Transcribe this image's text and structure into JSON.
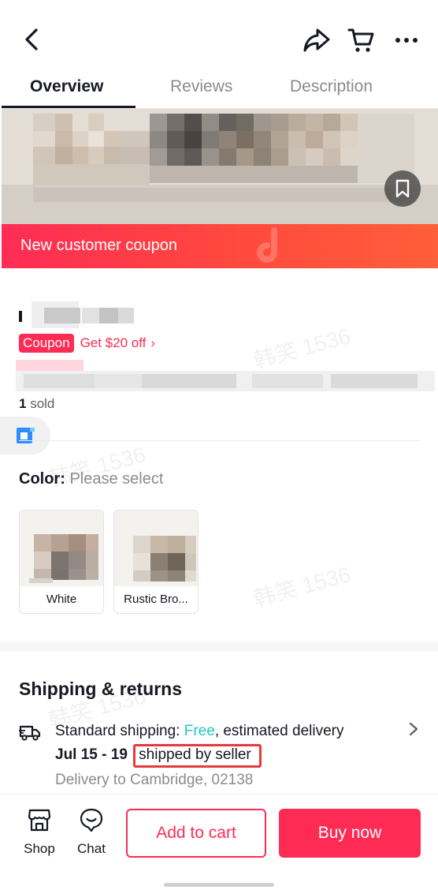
{
  "header": {
    "back_icon": "chevron-left-icon",
    "actions": [
      "share-icon",
      "cart-icon",
      "more-icon"
    ]
  },
  "tabs": [
    {
      "label": "Overview",
      "active": true
    },
    {
      "label": "Reviews",
      "active": false
    },
    {
      "label": "Description",
      "active": false
    }
  ],
  "banner": {
    "text": "New customer coupon"
  },
  "product": {
    "coupon_tag": "Coupon",
    "coupon_text": "Get $20 off",
    "coupon_chevron": "›",
    "sold_count": "1",
    "sold_label": "sold"
  },
  "color": {
    "label": "Color:",
    "value": "Please select",
    "variants": [
      {
        "name": "White"
      },
      {
        "name": "Rustic Bro..."
      }
    ]
  },
  "shipping": {
    "title": "Shipping & returns",
    "method_prefix": "Standard shipping: ",
    "free": "Free",
    "estimate": ", estimated delivery",
    "dates": "Jul 15 - 19",
    "shipped_by": "shipped by seller",
    "delivery_to": "Delivery to Cambridge, 02138"
  },
  "bottom_bar": {
    "shop_label": "Shop",
    "chat_label": "Chat",
    "add_to_cart": "Add to cart",
    "buy_now": "Buy now"
  },
  "watermark": "韩笑 1536",
  "colors": {
    "brand": "#fe2c55",
    "free": "#20c7c2",
    "highlight_box": "#e6393c"
  }
}
